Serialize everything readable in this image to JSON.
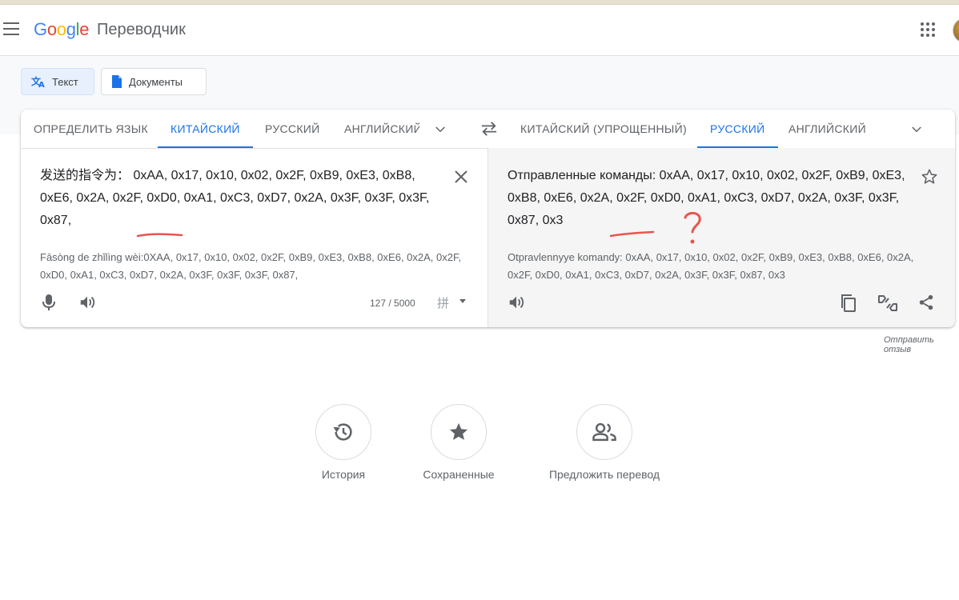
{
  "header": {
    "logo_letters": [
      "G",
      "o",
      "o",
      "g",
      "l",
      "e"
    ],
    "product": "Переводчик"
  },
  "modes": {
    "text_label": "Текст",
    "documents_label": "Документы"
  },
  "source_langs": {
    "detect": "ОПРЕДЕЛИТЬ ЯЗЫК",
    "chinese": "КИТАЙСКИЙ",
    "russian": "РУССКИЙ",
    "english": "АНГЛИЙСКИЙ"
  },
  "target_langs": {
    "chinese_simplified": "КИТАЙСКИЙ (УПРОЩЕННЫЙ)",
    "russian": "РУССКИЙ",
    "english": "АНГЛИЙСКИЙ"
  },
  "source": {
    "text": "发送的指令为：  0xAA, 0x17, 0x10, 0x02, 0x2F, 0xB9, 0xE3, 0xB8, 0xE6, 0x2A, 0x2F, 0xD0, 0xA1, 0xC3, 0xD7, 0x2A, 0x3F, 0x3F, 0x3F, 0x87,",
    "transliteration": "Fāsòng de zhǐlìng wèi:0XAA, 0x17, 0x10, 0x02, 0x2F, 0xB9, 0xE3, 0xB8, 0xE6, 0x2A, 0x2F, 0xD0, 0xA1, 0xC3, 0xD7, 0x2A, 0x3F, 0x3F, 0x3F, 0x87,",
    "char_count": "127 / 5000",
    "ime_glyph": "拼"
  },
  "target": {
    "text": "Отправленные команды: 0xAA, 0x17, 0x10, 0x02, 0x2F, 0xB9, 0xE3, 0xB8, 0xE6, 0x2A, 0x2F, 0xD0, 0xA1, 0xC3, 0xD7, 0x2A, 0x3F, 0x3F, 0x87, 0x3",
    "transliteration": "Otpravlennyye komandy: 0xAA, 0x17, 0x10, 0x02, 0x2F, 0xB9, 0xE3, 0xB8, 0xE6, 0x2A, 0x2F, 0xD0, 0xA1, 0xC3, 0xD7, 0x2A, 0x3F, 0x3F, 0x87, 0x3"
  },
  "feedback_link": "Отправить отзыв",
  "actions": {
    "history": "История",
    "saved": "Сохраненные",
    "contribute": "Предложить перевод"
  },
  "annotation": {
    "mark": "?",
    "color": "#e8554e"
  }
}
